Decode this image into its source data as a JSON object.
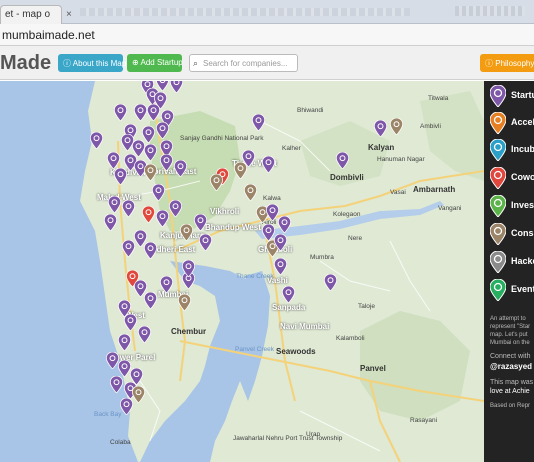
{
  "browser": {
    "tab_title": "et - map o",
    "tab_close": "×",
    "url": "mumbaimade.net"
  },
  "header": {
    "brand": "Made",
    "about_label": "About this Map",
    "add_label": "Add Startup",
    "search_placeholder": "Search for companies...",
    "philosophy_label": "Philosophy"
  },
  "sidebar": {
    "categories": [
      {
        "label": "Startu",
        "color": "#7e57a8",
        "icon": "power-icon"
      },
      {
        "label": "Accele",
        "color": "#e67e22",
        "icon": "rocket-icon"
      },
      {
        "label": "Incub",
        "color": "#2a9fc7",
        "icon": "gender-icon"
      },
      {
        "label": "Cowo",
        "color": "#e0483e",
        "icon": "car-icon"
      },
      {
        "label": "Invest",
        "color": "#5cb34a",
        "icon": "dollar-icon"
      },
      {
        "label": "Consu",
        "color": "#9b8467",
        "icon": "person-icon"
      },
      {
        "label": "Hacke",
        "color": "#8a8a8a",
        "icon": "wrench-icon"
      },
      {
        "label": "Event",
        "color": "#27ae60",
        "icon": "calendar-icon"
      }
    ],
    "intro_lines": [
      "An attempt to",
      "represent \"Star",
      "map. Let's put",
      "Mumbai on the"
    ],
    "connect_line": "Connect with",
    "handle": "@razasyed",
    "made_lines": [
      "This map was",
      "love at Achie"
    ],
    "based_line": "Based on Repr"
  },
  "map_labels": [
    {
      "text": "Bhiwandi",
      "kind": "normal"
    },
    {
      "text": "Titwala",
      "kind": "normal"
    },
    {
      "text": "Sanjay Gandhi National Park",
      "kind": "normal"
    },
    {
      "text": "Borivali East",
      "kind": "white"
    },
    {
      "text": "Kalyan",
      "kind": "big"
    },
    {
      "text": "Ambivli",
      "kind": "normal"
    },
    {
      "text": "Hanuman Nagar",
      "kind": "normal"
    },
    {
      "text": "Thane West",
      "kind": "white"
    },
    {
      "text": "Kalher",
      "kind": "normal"
    },
    {
      "text": "Dombivli",
      "kind": "big"
    },
    {
      "text": "Vasai",
      "kind": "normal"
    },
    {
      "text": "Kalwa",
      "kind": "normal"
    },
    {
      "text": "Kandivali",
      "kind": "white"
    },
    {
      "text": "Malad West",
      "kind": "white"
    },
    {
      "text": "Bhandup West",
      "kind": "white"
    },
    {
      "text": "Ambarnath",
      "kind": "big"
    },
    {
      "text": "Vangani",
      "kind": "normal"
    },
    {
      "text": "Kolegaon",
      "kind": "normal"
    },
    {
      "text": "Airoli",
      "kind": "normal"
    },
    {
      "text": "Ghansoli",
      "kind": "white"
    },
    {
      "text": "Nere",
      "kind": "normal"
    },
    {
      "text": "Taloje",
      "kind": "normal"
    },
    {
      "text": "Mumbra",
      "kind": "normal"
    },
    {
      "text": "Mumbai",
      "kind": "white"
    },
    {
      "text": "Navi Mumbai",
      "kind": "white"
    },
    {
      "text": "Chembur",
      "kind": "big"
    },
    {
      "text": "Sanpada",
      "kind": "white"
    },
    {
      "text": "Seawoods",
      "kind": "big"
    },
    {
      "text": "Kalamboli",
      "kind": "normal"
    },
    {
      "text": "Panvel",
      "kind": "big"
    },
    {
      "text": "Lower Parel",
      "kind": "white"
    },
    {
      "text": "Colaba",
      "kind": "normal"
    },
    {
      "text": "Jawaharlal Nehru Port Trust Township",
      "kind": "normal"
    },
    {
      "text": "Uran",
      "kind": "normal"
    },
    {
      "text": "Rasayani",
      "kind": "normal"
    },
    {
      "text": "Vashi",
      "kind": "white"
    },
    {
      "text": "Thane Creek",
      "kind": "water"
    },
    {
      "text": "Panvel Creek",
      "kind": "water"
    },
    {
      "text": "Back Bay",
      "kind": "water"
    },
    {
      "text": "Kanjurmarg",
      "kind": "white"
    },
    {
      "text": "Vikhroli",
      "kind": "white"
    },
    {
      "text": "Andheri East",
      "kind": "white"
    },
    {
      "text": "West",
      "kind": "white"
    }
  ]
}
